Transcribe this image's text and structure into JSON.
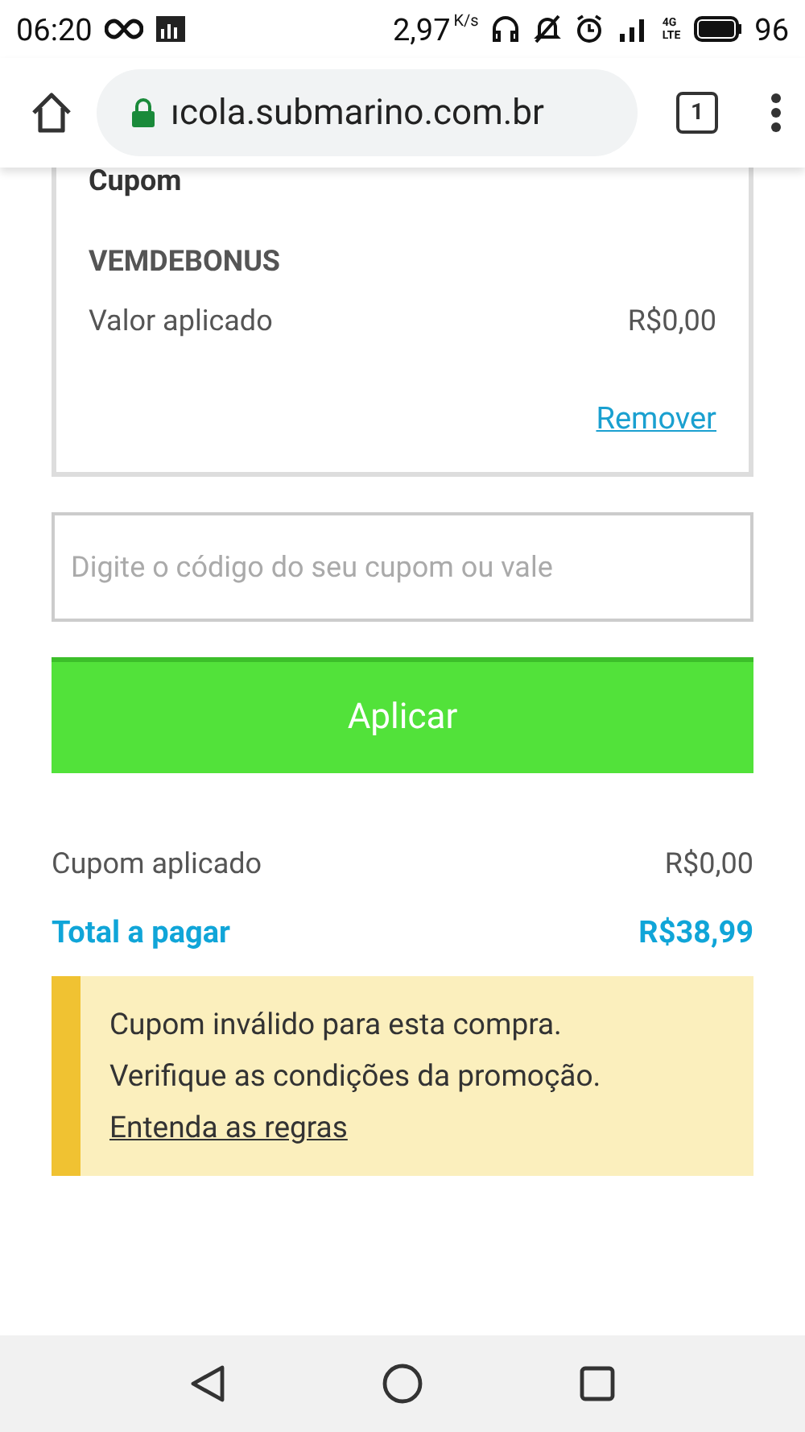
{
  "status_bar": {
    "time": "06:20",
    "speed": "2,97",
    "speed_unit": "K/s",
    "network": "4G",
    "network_sub": "LTE",
    "battery": "96"
  },
  "browser": {
    "url": "ıcola.submarino.com.br",
    "tab_count": "1"
  },
  "coupon_card": {
    "title": "Cupom",
    "code": "VEMDEBONUS",
    "label": "Valor aplicado",
    "value": "R$0,00",
    "remove_link": "Remover"
  },
  "coupon_input": {
    "placeholder": "Digite o código do seu cupom ou vale"
  },
  "apply_button": "Aplicar",
  "summary": [
    {
      "label": "Cupom aplicado",
      "value": "R$0,00",
      "kind": "plain"
    },
    {
      "label": "Total a pagar",
      "value": "R$38,99",
      "kind": "total"
    }
  ],
  "alert": {
    "lines": [
      "Cupom inválido para esta compra.",
      "Verifique as condições da promoção."
    ],
    "link": "Entenda as regras"
  }
}
